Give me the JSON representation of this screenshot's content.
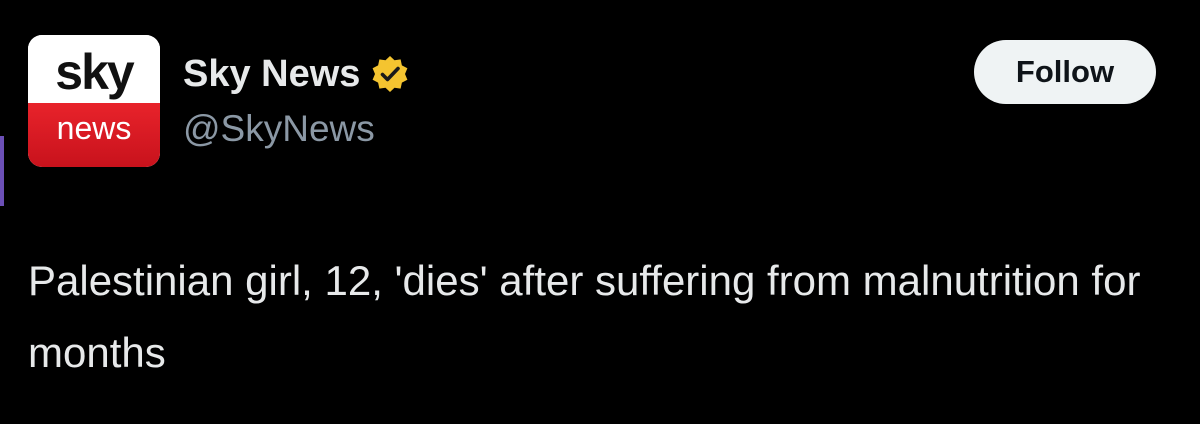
{
  "account": {
    "avatar": {
      "top_text": "sky",
      "bottom_text": "news",
      "brand_red": "#e8232b"
    },
    "display_name": "Sky News",
    "verified_icon": "verified-badge-gold",
    "verified_color": "#f4c430",
    "handle": "@SkyNews"
  },
  "actions": {
    "follow_label": "Follow"
  },
  "post": {
    "text": "Palestinian girl, 12, 'dies' after suffering from malnutrition for months"
  }
}
